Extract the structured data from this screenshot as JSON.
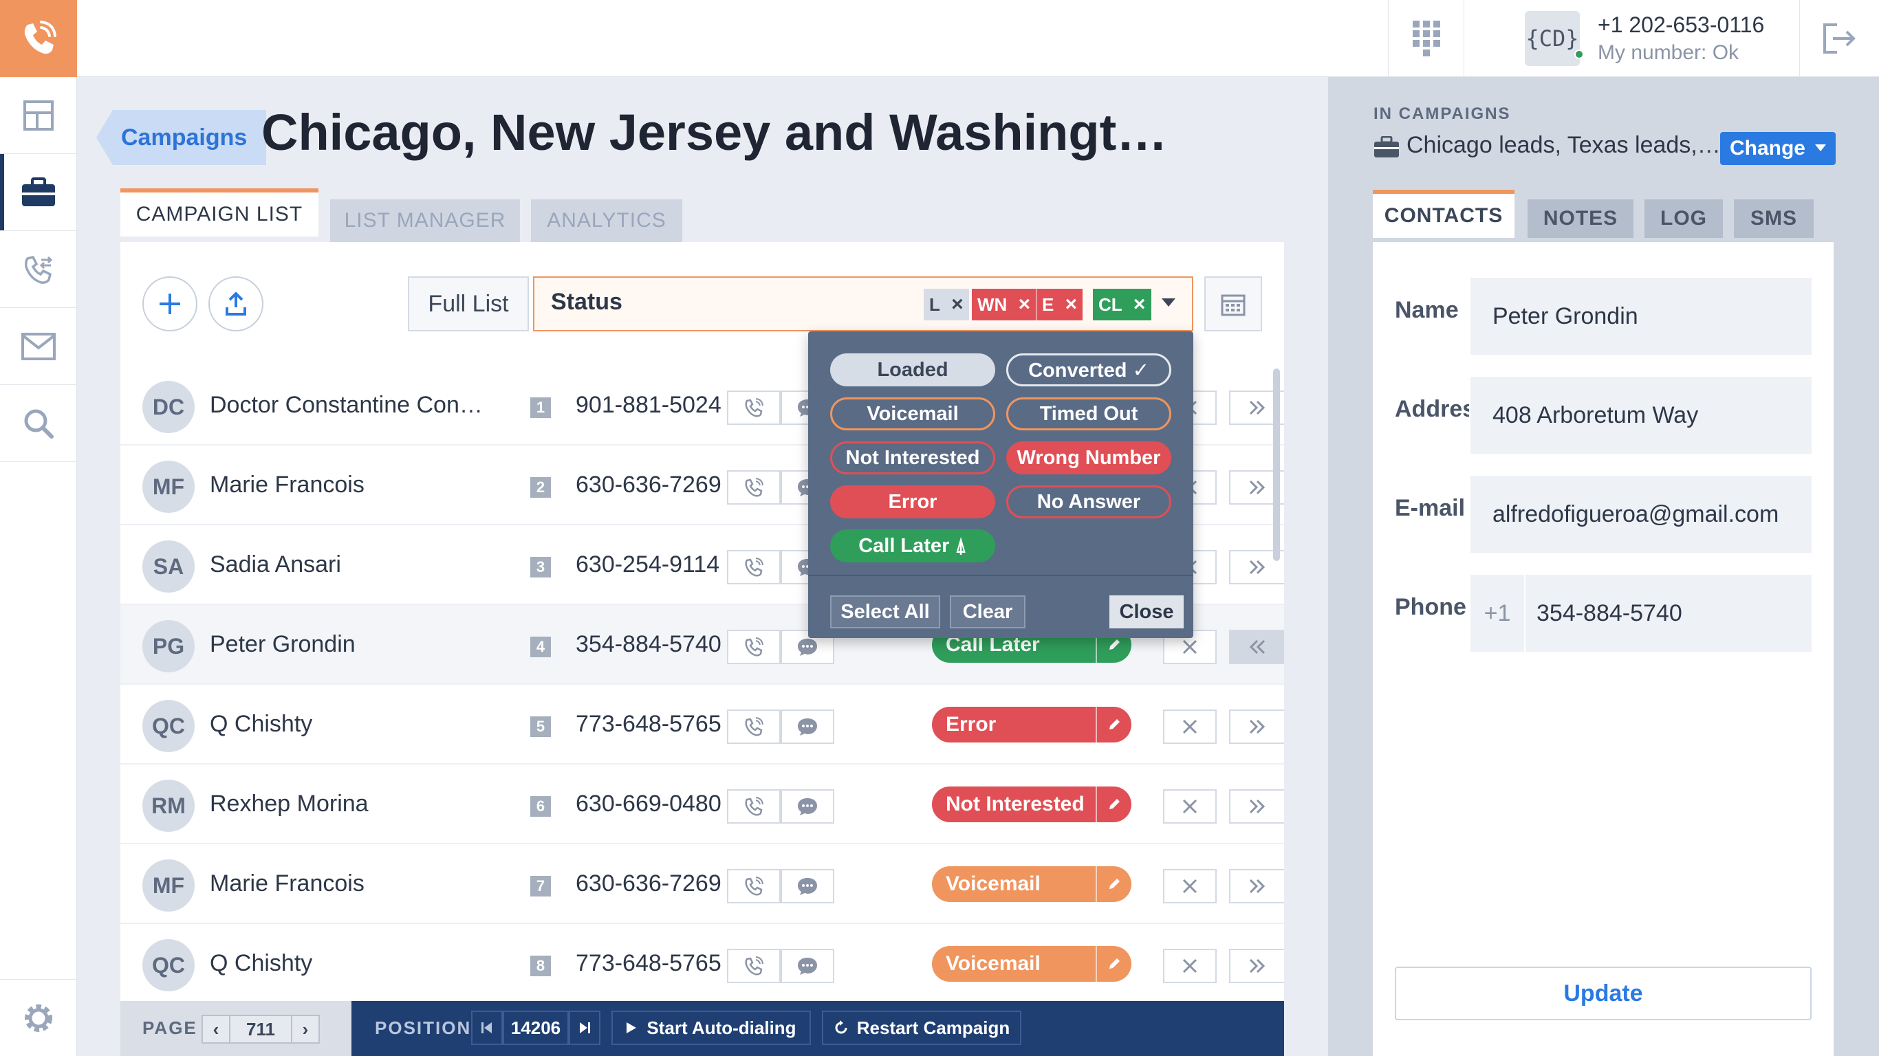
{
  "topbar": {
    "caller_badge": "{CD}",
    "caller_number": "+1 202-653-0116",
    "caller_status": "My number: Ok"
  },
  "header": {
    "breadcrumb": "Campaigns",
    "title": "Chicago, New Jersey and Washingt…"
  },
  "tabs": [
    {
      "label": "CAMPAIGN LIST",
      "active": true
    },
    {
      "label": "LIST MANAGER",
      "active": false
    },
    {
      "label": "ANALYTICS",
      "active": false
    }
  ],
  "toolbar": {
    "full_list": "Full List",
    "status_label": "Status",
    "status_chips": [
      {
        "code": "L",
        "color": "#d7dde7",
        "text_color": "#3b4658"
      },
      {
        "code": "WN",
        "color": "#e04f55",
        "text_color": "#ffffff"
      },
      {
        "code": "E",
        "color": "#e04f55",
        "text_color": "#ffffff"
      },
      {
        "code": "CL",
        "color": "#2f9e5b",
        "text_color": "#ffffff"
      }
    ]
  },
  "rows": [
    {
      "initials": "DC",
      "name": "Doctor Constantine Con…",
      "index": "1",
      "phone": "901-881-5024",
      "status": "",
      "status_color": ""
    },
    {
      "initials": "MF",
      "name": "Marie Francois",
      "index": "2",
      "phone": "630-636-7269",
      "status": "",
      "status_color": ""
    },
    {
      "initials": "SA",
      "name": "Sadia Ansari",
      "index": "3",
      "phone": "630-254-9114",
      "status": "",
      "status_color": ""
    },
    {
      "initials": "PG",
      "name": "Peter Grondin",
      "index": "4",
      "phone": "354-884-5740",
      "status": "Call Later",
      "status_color": "#2f9e5b"
    },
    {
      "initials": "QC",
      "name": "Q Chishty",
      "index": "5",
      "phone": "773-648-5765",
      "status": "Error",
      "status_color": "#e04f55"
    },
    {
      "initials": "RM",
      "name": "Rexhep Morina",
      "index": "6",
      "phone": "630-669-0480",
      "status": "Not Interested",
      "status_color": "#e04f55"
    },
    {
      "initials": "MF",
      "name": "Marie Francois",
      "index": "7",
      "phone": "630-636-7269",
      "status": "Voicemail",
      "status_color": "#f0955e"
    },
    {
      "initials": "QC",
      "name": "Q Chishty",
      "index": "8",
      "phone": "773-648-5765",
      "status": "Voicemail",
      "status_color": "#f0955e"
    }
  ],
  "dropdown": {
    "options": [
      {
        "label": "Loaded",
        "style": "loaded"
      },
      {
        "label": "Converted ✓",
        "style": "converted"
      },
      {
        "label": "Voicemail",
        "style": "voicemail"
      },
      {
        "label": "Timed Out",
        "style": "timedout"
      },
      {
        "label": "Not Interested",
        "style": "notinterested"
      },
      {
        "label": "Wrong Number",
        "style": "wrongnumber"
      },
      {
        "label": "Error",
        "style": "error"
      },
      {
        "label": "No Answer",
        "style": "noanswer"
      },
      {
        "label": "Call Later ⍋",
        "style": "calllater"
      }
    ],
    "select_all": "Select All",
    "clear": "Clear",
    "close": "Close"
  },
  "footer": {
    "page_label": "PAGE",
    "page_value": "711",
    "position_label": "POSITION",
    "position_value": "14206",
    "start_autodial": "Start Auto-dialing",
    "restart_campaign": "Restart Campaign"
  },
  "right_panel": {
    "in_campaigns_label": "IN CAMPAIGNS",
    "in_campaigns_value": "Chicago leads, Texas leads,…",
    "change_label": "Change",
    "tabs": [
      {
        "label": "CONTACTS",
        "active": true
      },
      {
        "label": "NOTES",
        "active": false
      },
      {
        "label": "LOG",
        "active": false
      },
      {
        "label": "SMS",
        "active": false
      }
    ],
    "fields": {
      "name_label": "Name",
      "name_value": "Peter Grondin",
      "address_label": "Address",
      "address_value": "408 Arboretum Way",
      "email_label": "E-mail",
      "email_value": "alfredofigueroa@gmail.com",
      "phone_label": "Phone",
      "phone_prefix": "+1",
      "phone_value": "354-884-5740"
    },
    "update_label": "Update"
  },
  "colors": {
    "accent_orange": "#f0955e",
    "navy": "#1f3f73",
    "blue": "#2a7ae2",
    "red": "#e04f55",
    "green": "#2f9e5b"
  }
}
